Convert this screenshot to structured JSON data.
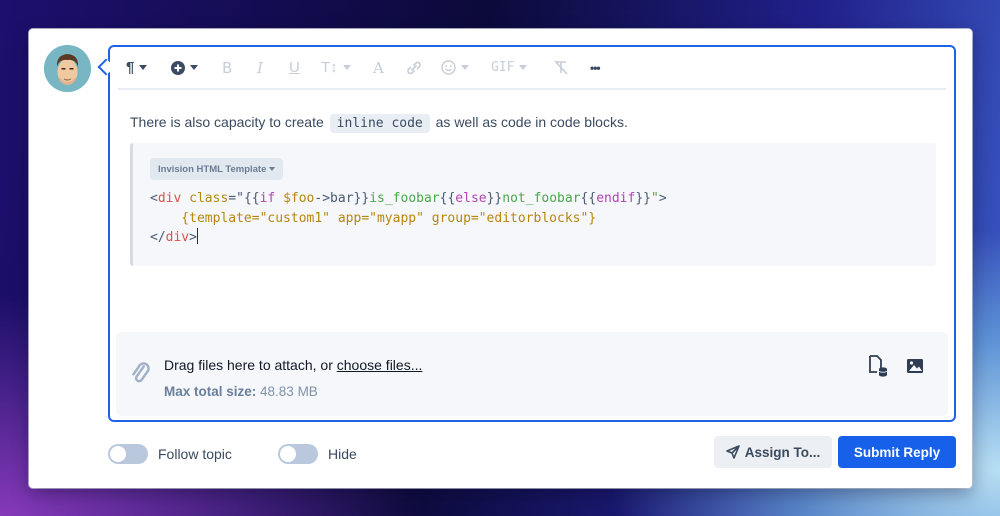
{
  "avatar": {
    "alt": "User avatar"
  },
  "toolbar": {
    "items": [
      {
        "name": "paragraph-format",
        "glyph": "¶",
        "dropdown": true,
        "active": true
      },
      {
        "name": "insert",
        "glyph": "+",
        "dropdown": true,
        "active": true
      },
      {
        "name": "bold",
        "glyph": "B",
        "dropdown": false,
        "active": false
      },
      {
        "name": "italic",
        "glyph": "I",
        "dropdown": false,
        "active": false
      },
      {
        "name": "underline",
        "glyph": "U",
        "dropdown": false,
        "active": false
      },
      {
        "name": "text-size",
        "glyph": "T↕",
        "dropdown": true,
        "active": false
      },
      {
        "name": "text-color",
        "glyph": "A",
        "dropdown": false,
        "active": false
      },
      {
        "name": "link",
        "glyph": "🔗",
        "dropdown": false,
        "active": false
      },
      {
        "name": "emoji",
        "glyph": "☺",
        "dropdown": true,
        "active": false
      },
      {
        "name": "gif",
        "glyph": "GIF",
        "dropdown": true,
        "active": false
      },
      {
        "name": "clear-formatting",
        "glyph": "T̸",
        "dropdown": false,
        "active": false
      },
      {
        "name": "more",
        "glyph": "•••",
        "dropdown": false,
        "active": true
      }
    ]
  },
  "content": {
    "para_before": "There is also capacity to create ",
    "inline_code": "inline code",
    "para_after": " as well as code in code blocks.",
    "code_block": {
      "language": "Invision HTML Template",
      "lines": [
        [
          {
            "t": "<",
            "c": "punc"
          },
          {
            "t": "div",
            "c": "tag"
          },
          {
            "t": " class",
            "c": "attr"
          },
          {
            "t": "=\"",
            "c": "punc"
          },
          {
            "t": "{{",
            "c": "punc"
          },
          {
            "t": "if",
            "c": "kw"
          },
          {
            "t": " $foo",
            "c": "var"
          },
          {
            "t": "->bar}}",
            "c": "punc"
          },
          {
            "t": "is_foobar",
            "c": "str"
          },
          {
            "t": "{{",
            "c": "punc"
          },
          {
            "t": "else",
            "c": "kw"
          },
          {
            "t": "}}",
            "c": "punc"
          },
          {
            "t": "not_foobar",
            "c": "str"
          },
          {
            "t": "{{",
            "c": "punc"
          },
          {
            "t": "endif",
            "c": "kw"
          },
          {
            "t": "}}",
            "c": "punc"
          },
          {
            "t": "\"",
            "c": "str"
          },
          {
            "t": ">",
            "c": "punc"
          }
        ],
        [
          {
            "t": "    {template=\"custom1\" app=\"myapp\" group=\"editorblocks\"}",
            "c": "attr"
          }
        ],
        [
          {
            "t": "</",
            "c": "punc"
          },
          {
            "t": "div",
            "c": "tag"
          },
          {
            "t": ">",
            "c": "punc"
          }
        ]
      ]
    }
  },
  "attachments": {
    "drag_text": "Drag files here to attach, or ",
    "choose_link": "choose files...",
    "max_label": "Max total size:",
    "max_value": " 48.83 MB"
  },
  "footer": {
    "follow_label": "Follow topic",
    "follow_on": false,
    "hide_label": "Hide",
    "hide_on": false,
    "assign_label": "Assign To...",
    "submit_label": "Submit Reply"
  },
  "colors": {
    "accent": "#1f63e6",
    "submit_bg": "#1660ea"
  }
}
